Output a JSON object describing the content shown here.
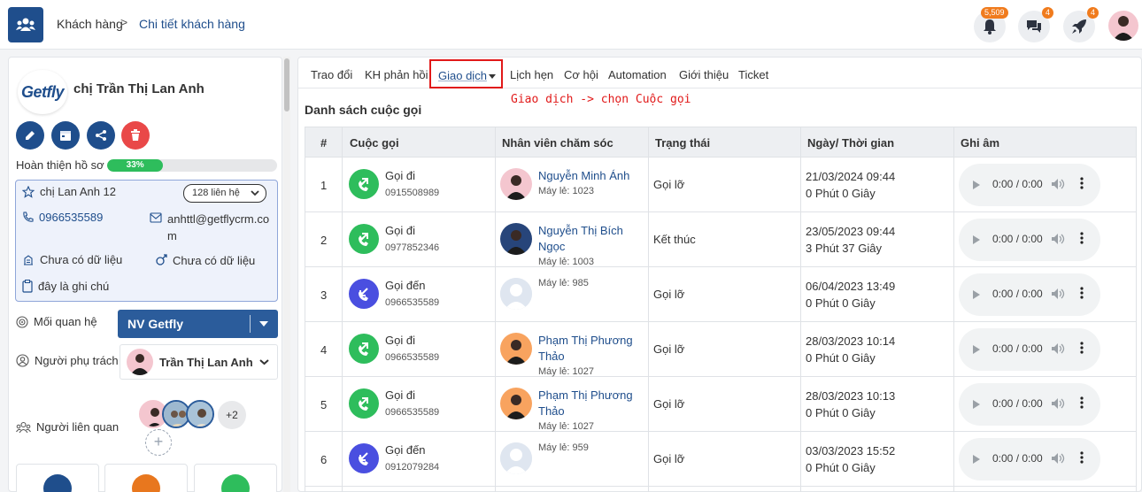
{
  "breadcrumb": {
    "home": "Khách hàng",
    "separator": ">",
    "current": "Chi tiết khách hàng"
  },
  "topbar": {
    "notifications_badge": "5,509",
    "messages_badge": "4",
    "rocket_badge": "4"
  },
  "customer": {
    "logo_text_main": "Getfly",
    "name": "chị Trần Thị Lan Anh",
    "profile_label": "Hoàn thiện hồ sơ",
    "profile_percent_label": "33%",
    "profile_percent": 33,
    "contact_name": "chị Lan Anh 12",
    "contacts_select": "128 liên hệ",
    "phone": "0966535589",
    "email": "anhttl@getflycrm.com",
    "field1": "Chưa có dữ liệu",
    "field2": "Chưa có dữ liệu",
    "note": "đây là ghi chú"
  },
  "relations": {
    "relationship_label": "Mối quan hệ",
    "relationship_value": "NV Getfly",
    "owner_label": "Người phụ trách",
    "owner_value": "Trần Thị Lan Anh",
    "related_label": "Người liên quan",
    "related_more": "+2",
    "add_symbol": "+"
  },
  "tabs": [
    {
      "label": "Trao đổi"
    },
    {
      "label": "KH phản hồi"
    },
    {
      "label": "Giao dịch"
    },
    {
      "label": "Lịch hẹn"
    },
    {
      "label": "Cơ hội"
    },
    {
      "label": "Automation"
    },
    {
      "label": "Giới thiệu"
    },
    {
      "label": "Ticket"
    }
  ],
  "annotation": "Giao dịch -> chọn Cuộc gọi",
  "call_list": {
    "title": "Danh sách cuộc gọi",
    "headers": [
      "#",
      "Cuộc gọi",
      "Nhân viên chăm sóc",
      "Trạng thái",
      "Ngày/ Thời gian",
      "Ghi âm"
    ],
    "rows": [
      {
        "n": "1",
        "type": "Gọi đi",
        "direction": "out",
        "number": "0915508989",
        "staff": "Nguyễn Minh Ánh",
        "ext": "Máy lẻ: 1023",
        "status": "Gọi lỡ",
        "date": "21/03/2024 09:44",
        "duration": "0 Phút 0 Giây",
        "audio": "0:00 / 0:00"
      },
      {
        "n": "2",
        "type": "Gọi đi",
        "direction": "out",
        "number": "0977852346",
        "staff": "Nguyễn Thị Bích Ngọc",
        "ext": "Máy lẻ: 1003",
        "status": "Kết thúc",
        "date": "23/05/2023 09:44",
        "duration": "3 Phút 37 Giây",
        "audio": "0:00 / 0:00"
      },
      {
        "n": "3",
        "type": "Gọi đến",
        "direction": "in",
        "number": "0966535589",
        "staff": "",
        "ext": "Máy lẻ: 985",
        "status": "Gọi lỡ",
        "date": "06/04/2023 13:49",
        "duration": "0 Phút 0 Giây",
        "audio": "0:00 / 0:00"
      },
      {
        "n": "4",
        "type": "Gọi đi",
        "direction": "out",
        "number": "0966535589",
        "staff": "Phạm Thị Phương Thảo",
        "ext": "Máy lẻ: 1027",
        "status": "Gọi lỡ",
        "date": "28/03/2023 10:14",
        "duration": "0 Phút 0 Giây",
        "audio": "0:00 / 0:00"
      },
      {
        "n": "5",
        "type": "Gọi đi",
        "direction": "out",
        "number": "0966535589",
        "staff": "Phạm Thị Phương Thảo",
        "ext": "Máy lẻ: 1027",
        "status": "Gọi lỡ",
        "date": "28/03/2023 10:13",
        "duration": "0 Phút 0 Giây",
        "audio": "0:00 / 0:00"
      },
      {
        "n": "6",
        "type": "Gọi đến",
        "direction": "in",
        "number": "0912079284",
        "staff": "",
        "ext": "Máy lẻ: 959",
        "status": "Gọi lỡ",
        "date": "03/03/2023 15:52",
        "duration": "0 Phút 0 Giây",
        "audio": "0:00 / 0:00"
      }
    ]
  },
  "colors": {
    "brand_blue": "#1f4e8c",
    "call_out": "#2ebd5c",
    "call_in": "#4a4fe0",
    "badge": "#f07b1d",
    "highlight": "#e11919"
  }
}
